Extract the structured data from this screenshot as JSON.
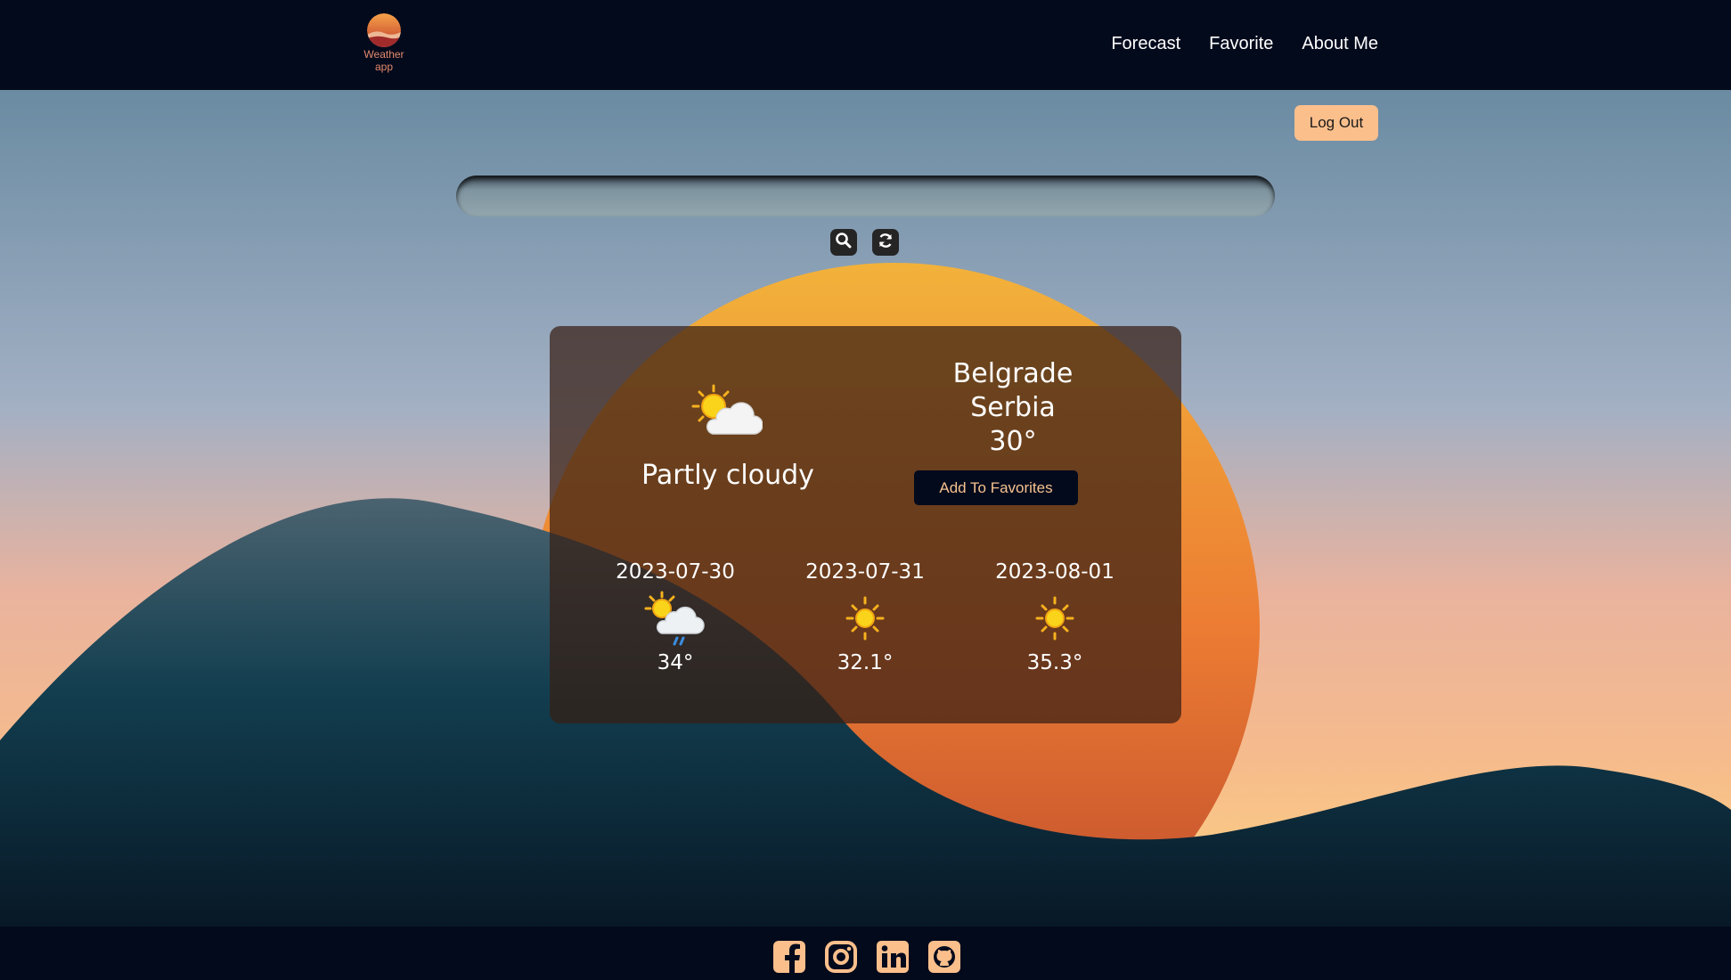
{
  "header": {
    "logo_text_line1": "Weather",
    "logo_text_line2": "app",
    "nav": [
      {
        "label": "Forecast"
      },
      {
        "label": "Favorite"
      },
      {
        "label": "About Me"
      }
    ]
  },
  "logout_label": "Log Out",
  "search": {
    "value": "",
    "placeholder": ""
  },
  "icons": {
    "search": "search-icon",
    "refresh": "refresh-icon"
  },
  "current": {
    "condition": "Partly cloudy",
    "condition_icon": "partly-cloudy-icon",
    "city": "Belgrade",
    "country": "Serbia",
    "temperature": "30°",
    "add_favorites_label": "Add To Favorites"
  },
  "forecast": [
    {
      "date": "2023-07-30",
      "icon": "sun-cloud-rain-icon",
      "temp": "34°"
    },
    {
      "date": "2023-07-31",
      "icon": "sun-icon",
      "temp": "32.1°"
    },
    {
      "date": "2023-08-01",
      "icon": "sun-icon",
      "temp": "35.3°"
    }
  ],
  "social": [
    "facebook-icon",
    "instagram-icon",
    "linkedin-icon",
    "github-icon"
  ],
  "colors": {
    "header_bg": "#030a1c",
    "accent": "#fbbf8c",
    "sun_top": "#f2b23a",
    "sun_bottom": "#d8522a",
    "hill": "#0f3443"
  }
}
